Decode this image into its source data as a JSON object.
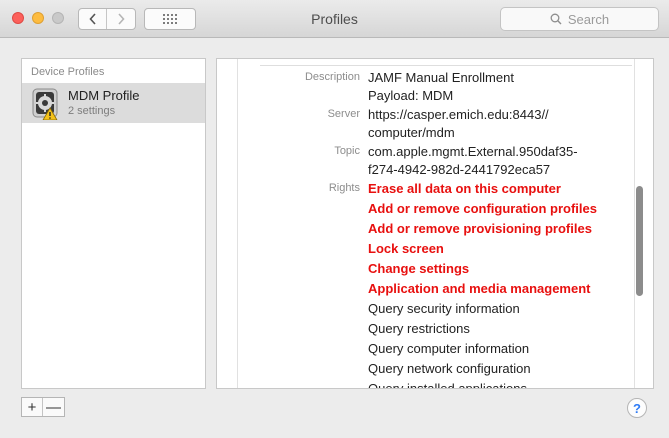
{
  "window": {
    "title": "Profiles"
  },
  "toolbar": {
    "back_glyph": "‹",
    "forward_glyph": "›",
    "search_placeholder": "Search"
  },
  "sidebar": {
    "header": "Device Profiles",
    "items": [
      {
        "name": "MDM Profile",
        "sub": "2 settings",
        "icon": "gear-profile-warning-icon"
      }
    ]
  },
  "detail": {
    "description_label": "Description",
    "description_lines": [
      "JAMF Manual Enrollment",
      "Payload: MDM"
    ],
    "server_label": "Server",
    "server_lines": [
      "https://casper.emich.edu:8443//",
      "computer/mdm"
    ],
    "topic_label": "Topic",
    "topic_lines": [
      "com.apple.mgmt.External.950daf35-",
      "f274-4942-982d-2441792eca57"
    ],
    "rights_label": "Rights",
    "rights": [
      {
        "text": "Erase all data on this computer",
        "red": true
      },
      {
        "text": "Add or remove configuration profiles",
        "red": true
      },
      {
        "text": "Add or remove provisioning profiles",
        "red": true
      },
      {
        "text": "Lock screen",
        "red": true
      },
      {
        "text": "Change settings",
        "red": true
      },
      {
        "text": "Application and media management",
        "red": true
      },
      {
        "text": "Query security information",
        "red": false
      },
      {
        "text": "Query restrictions",
        "red": false
      },
      {
        "text": "Query computer information",
        "red": false
      },
      {
        "text": "Query network configuration",
        "red": false
      },
      {
        "text": "Query installed applications",
        "red": false
      }
    ]
  },
  "bottom": {
    "add_label": "+",
    "remove_label": "—",
    "help_label": "?"
  },
  "colors": {
    "warning_red": "#e8100f",
    "accent": "#2e7bf6"
  }
}
